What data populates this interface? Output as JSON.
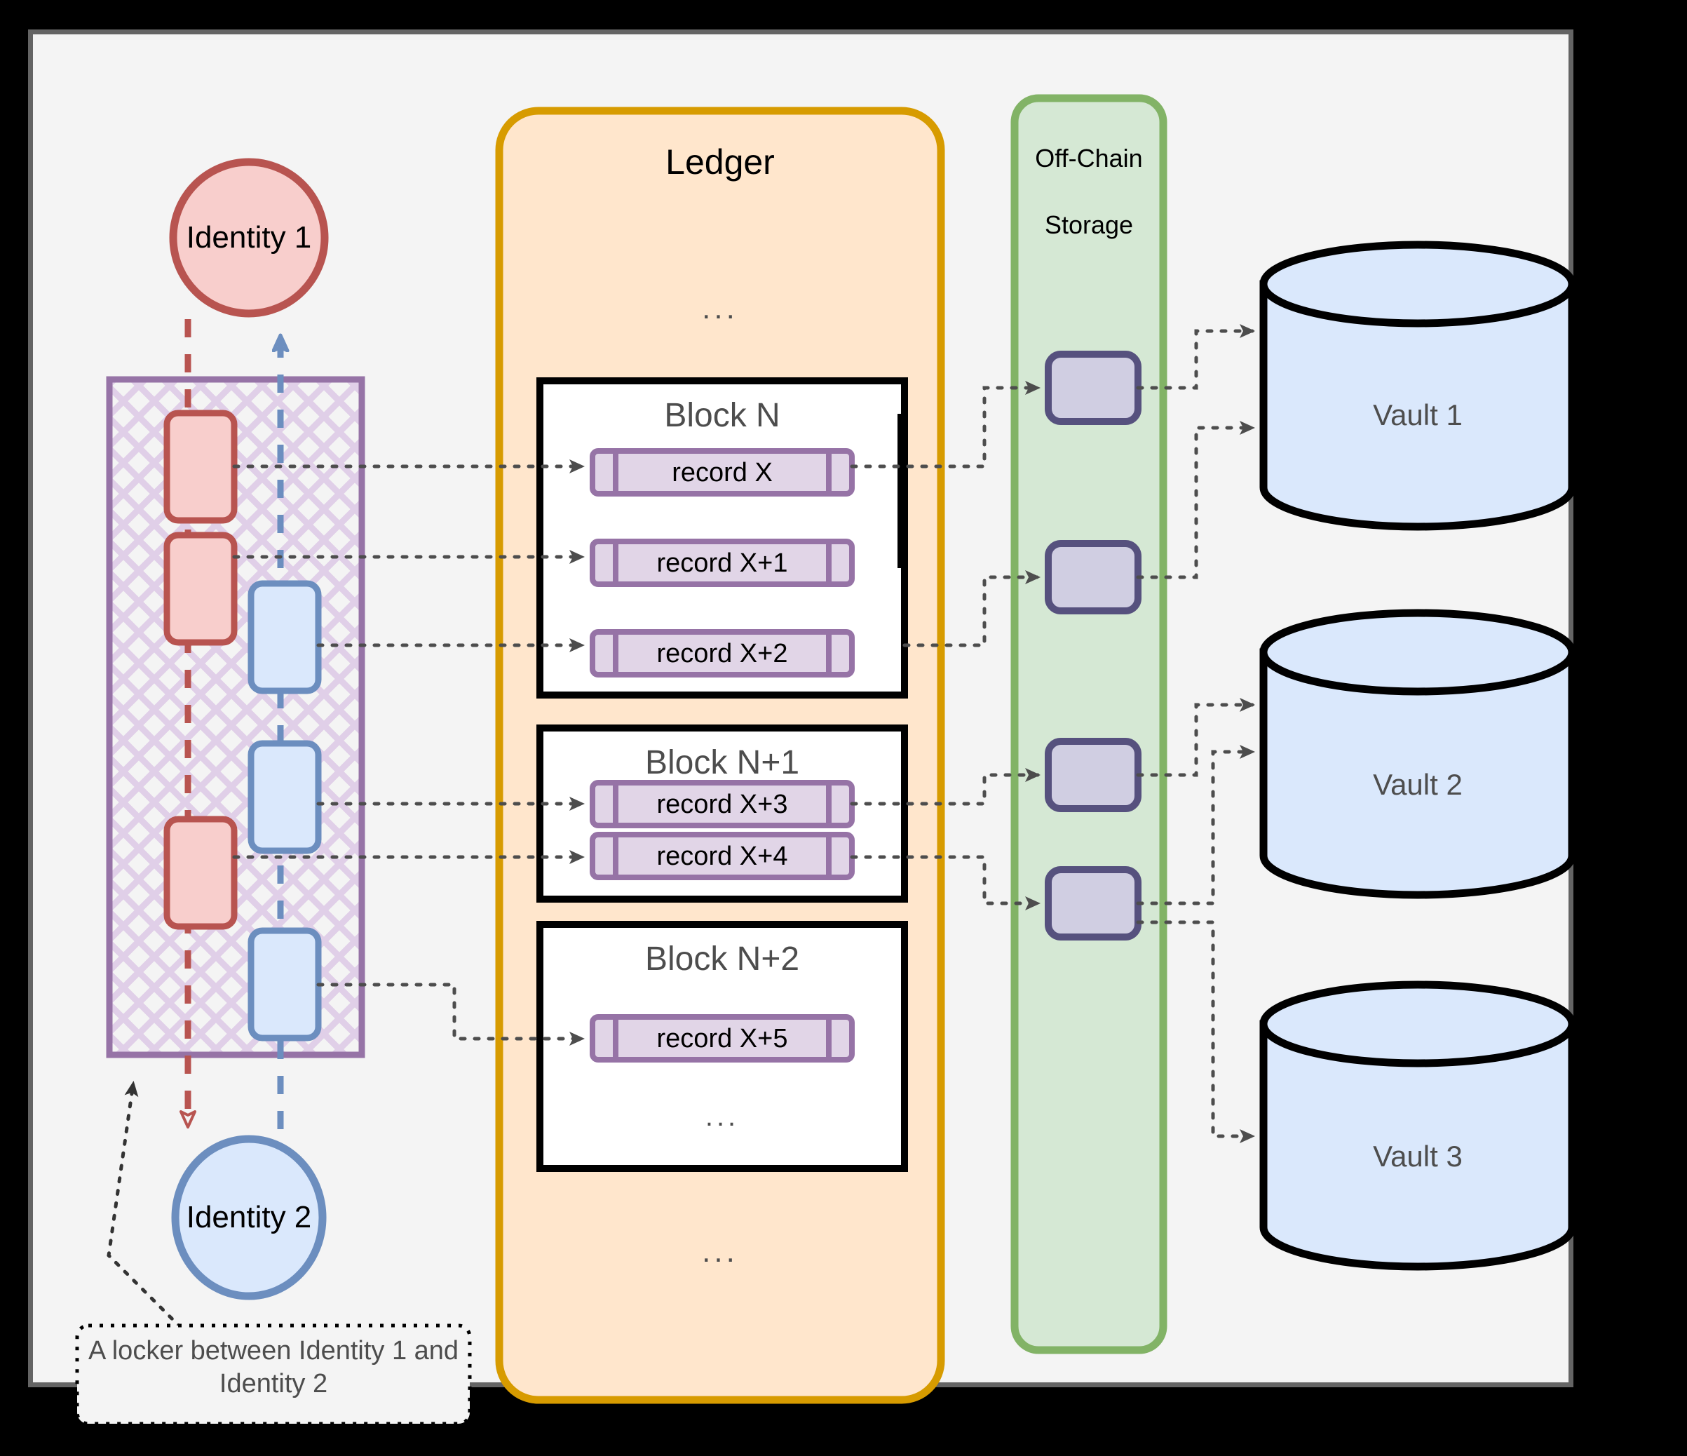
{
  "diagram": {
    "identities": [
      {
        "name": "identity-1",
        "label": "Identity 1"
      },
      {
        "name": "identity-2",
        "label": "Identity 2"
      }
    ],
    "locker": {
      "caption": "A locker between Identity 1 and Identity 2"
    },
    "ledger": {
      "title": "Ledger",
      "ellipsis_top": "...",
      "ellipsis_bottom": "...",
      "blocks": [
        {
          "title": "Block N",
          "records": [
            "record X",
            "record X+1",
            "record X+2"
          ],
          "ellipsis": ""
        },
        {
          "title": "Block N+1",
          "records": [
            "record X+3",
            "record X+4"
          ],
          "ellipsis": ""
        },
        {
          "title": "Block N+2",
          "records": [
            "record X+5"
          ],
          "ellipsis": "..."
        }
      ]
    },
    "offchain": {
      "title_line1": "Off-Chain",
      "title_line2": "Storage",
      "blobs": [
        "blob-1",
        "blob-2",
        "blob-3",
        "blob-4"
      ]
    },
    "vaults": [
      {
        "name": "vault-1",
        "label": "Vault 1"
      },
      {
        "name": "vault-2",
        "label": "Vault 2"
      },
      {
        "name": "vault-3",
        "label": "Vault 3"
      }
    ],
    "colors": {
      "canvas_bg": "#f4f4f4",
      "identity1_fill": "#f8cecc",
      "identity1_stroke": "#b85450",
      "identity2_fill": "#dae8fc",
      "identity2_stroke": "#6c8ebf",
      "ledger_fill": "#ffe6cc",
      "ledger_stroke": "#d79b00",
      "offchain_fill": "#d5e8d4",
      "offchain_stroke": "#82b366",
      "record_fill": "#e1d5e7",
      "record_stroke": "#9673a6",
      "blob_stroke": "#56517e",
      "locker_stroke": "#9673a6",
      "vault_fill": "#dae8fc",
      "vault_stroke": "#000000",
      "connector": "#4d4d4d",
      "text_dark": "#4d4d4d",
      "text_black": "#000000"
    }
  }
}
